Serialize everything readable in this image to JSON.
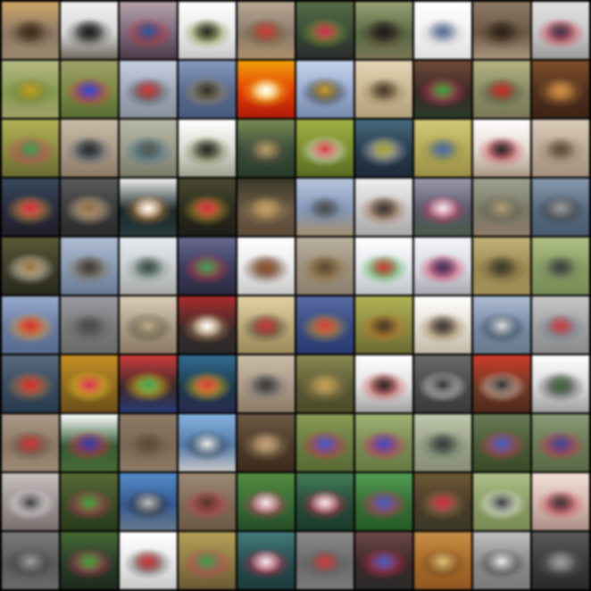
{
  "grid": {
    "rows": 10,
    "cols": 10,
    "border_color": "#000000",
    "tiles": [
      {
        "bg": "#8a7a6a",
        "top": "#c9a66e",
        "mid": "#5a4630",
        "bottom": "#9a8a72",
        "accent": "#3a2a1e"
      },
      {
        "bg": "#d8d8d8",
        "top": "#f0f0f0",
        "mid": "#3a3a34",
        "bottom": "#6e6a5e",
        "accent": "#1e1e1e"
      },
      {
        "bg": "#7a6a7a",
        "top": "#b4a4a8",
        "mid": "#b03030",
        "bottom": "#4a3a44",
        "accent": "#2a5a9a"
      },
      {
        "bg": "#e8e8e8",
        "top": "#ffffff",
        "mid": "#7a8a3a",
        "bottom": "#c8c8c8",
        "accent": "#2a2a2a"
      },
      {
        "bg": "#8a7a6e",
        "top": "#b8a898",
        "mid": "#6a5a3a",
        "bottom": "#a89070",
        "accent": "#c04040"
      },
      {
        "bg": "#3a4a3a",
        "top": "#5a6a4a",
        "mid": "#8aa040",
        "bottom": "#2a2a2a",
        "accent": "#c03050"
      },
      {
        "bg": "#5a6a4a",
        "top": "#9aa07a",
        "mid": "#3a2e22",
        "bottom": "#7a7458",
        "accent": "#1e1e1a"
      },
      {
        "bg": "#f2f2f2",
        "top": "#ffffff",
        "mid": "#b4b8c0",
        "bottom": "#e0e0e0",
        "accent": "#5a6a8a"
      },
      {
        "bg": "#6a5a4a",
        "top": "#8a7a6a",
        "mid": "#4a3a2a",
        "bottom": "#a89880",
        "accent": "#2a2018"
      },
      {
        "bg": "#c8c8c8",
        "top": "#e0e0e0",
        "mid": "#c03040",
        "bottom": "#9a9a9a",
        "accent": "#3a3a4a"
      },
      {
        "bg": "#8a9a5a",
        "top": "#b4b88a",
        "mid": "#6a7a3a",
        "bottom": "#a0a070",
        "accent": "#c0a030"
      },
      {
        "bg": "#7a8a4a",
        "top": "#a0a070",
        "mid": "#c03050",
        "bottom": "#5a6a3a",
        "accent": "#3050c0"
      },
      {
        "bg": "#a0a8b8",
        "top": "#c8d0e0",
        "mid": "#4a4a4a",
        "bottom": "#8a909a",
        "accent": "#c04040"
      },
      {
        "bg": "#5a6a8a",
        "top": "#8a9ab8",
        "mid": "#a08a5a",
        "bottom": "#4a5a7a",
        "accent": "#2a2a2a"
      },
      {
        "bg": "#d04010",
        "top": "#e8a020",
        "mid": "#f0d040",
        "bottom": "#a02010",
        "accent": "#ffffff"
      },
      {
        "bg": "#9aaac8",
        "top": "#c8d4e8",
        "mid": "#2a2a2a",
        "bottom": "#7a8aa8",
        "accent": "#c8a040"
      },
      {
        "bg": "#c8b898",
        "top": "#e0d4b8",
        "mid": "#8a7a5a",
        "bottom": "#b0a080",
        "accent": "#4a3a2a"
      },
      {
        "bg": "#3a2a2a",
        "top": "#6a4a3a",
        "mid": "#c04060",
        "bottom": "#2a3a2a",
        "accent": "#40a040"
      },
      {
        "bg": "#8a8a6a",
        "top": "#b4b48a",
        "mid": "#4a5a3a",
        "bottom": "#7a7a5a",
        "accent": "#c03030"
      },
      {
        "bg": "#4a3020",
        "top": "#7a5030",
        "mid": "#a07040",
        "bottom": "#3a2418",
        "accent": "#c89050"
      },
      {
        "bg": "#8a8a4a",
        "top": "#b0b060",
        "mid": "#c04060",
        "bottom": "#6a6a3a",
        "accent": "#40a050"
      },
      {
        "bg": "#a89a8a",
        "top": "#c8bca8",
        "mid": "#4a5a6a",
        "bottom": "#8a7a6a",
        "accent": "#2a2a2a"
      },
      {
        "bg": "#9a9a8a",
        "top": "#b8b8a8",
        "mid": "#3a6a8a",
        "bottom": "#7a7a6a",
        "accent": "#5a5a4a"
      },
      {
        "bg": "#d8d8d0",
        "top": "#ffffff",
        "mid": "#5a6a3a",
        "bottom": "#a0a090",
        "accent": "#2a2a2a"
      },
      {
        "bg": "#3a4a3a",
        "top": "#7a8a5a",
        "mid": "#6a5a4a",
        "bottom": "#2a3a2a",
        "accent": "#b0a070"
      },
      {
        "bg": "#7a8a3a",
        "top": "#a0b050",
        "mid": "#f0f0f0",
        "bottom": "#5a6a2a",
        "accent": "#c04040"
      },
      {
        "bg": "#2a3a4a",
        "top": "#4a6a7a",
        "mid": "#c0c0c0",
        "bottom": "#1e2a34",
        "accent": "#a0a040"
      },
      {
        "bg": "#b0a860",
        "top": "#d0c880",
        "mid": "#8a8a5a",
        "bottom": "#9a9050",
        "accent": "#4a6aa0"
      },
      {
        "bg": "#e0d8d0",
        "top": "#ffffff",
        "mid": "#c04050",
        "bottom": "#a89888",
        "accent": "#2a2a2a"
      },
      {
        "bg": "#b8a898",
        "top": "#d8ccbc",
        "mid": "#8a7a6a",
        "bottom": "#a09080",
        "accent": "#5a4a3a"
      },
      {
        "bg": "#2a2a3a",
        "top": "#3a4a5a",
        "mid": "#c8a050",
        "bottom": "#1e1e28",
        "accent": "#c03040"
      },
      {
        "bg": "#3a3a3a",
        "top": "#5a5a5a",
        "mid": "#d8c0a0",
        "bottom": "#2a2a2a",
        "accent": "#8a6a4a"
      },
      {
        "bg": "#1e2a2a",
        "top": "#f0f0f0",
        "mid": "#c08040",
        "bottom": "#2a3a3a",
        "accent": "#ffffff"
      },
      {
        "bg": "#2a2a1e",
        "top": "#4a4a34",
        "mid": "#c0a040",
        "bottom": "#1e1e18",
        "accent": "#c03040"
      },
      {
        "bg": "#6a5a4a",
        "top": "#3a3a2a",
        "mid": "#a08a5a",
        "bottom": "#5a4a3a",
        "accent": "#c0a070"
      },
      {
        "bg": "#8a9ab8",
        "top": "#b8c4d8",
        "mid": "#6a7a8a",
        "bottom": "#a09070",
        "accent": "#4a4a4a"
      },
      {
        "bg": "#c8c8c8",
        "top": "#f0f0f0",
        "mid": "#8a5a3a",
        "bottom": "#a8a8a8",
        "accent": "#3a3a3a"
      },
      {
        "bg": "#5a5a6a",
        "top": "#9a9aaa",
        "mid": "#c04060",
        "bottom": "#4a5a4a",
        "accent": "#f0f0f0"
      },
      {
        "bg": "#7a7a6a",
        "top": "#a0a090",
        "mid": "#5a5a4a",
        "bottom": "#8a7a6a",
        "accent": "#b0a080"
      },
      {
        "bg": "#5a6a7a",
        "top": "#8a9aaa",
        "mid": "#3a3a3a",
        "bottom": "#4a5a6a",
        "accent": "#a0a0a0"
      },
      {
        "bg": "#3a3a2a",
        "top": "#5a5a3a",
        "mid": "#f0e8d8",
        "bottom": "#2a2a1e",
        "accent": "#8a6a3a"
      },
      {
        "bg": "#8a9ab0",
        "top": "#b0bcd0",
        "mid": "#7a6a4a",
        "bottom": "#6a7a90",
        "accent": "#3a3a3a"
      },
      {
        "bg": "#c8ccd0",
        "top": "#e8ecf0",
        "mid": "#7a8a7a",
        "bottom": "#a8aaa8",
        "accent": "#3a4a4a"
      },
      {
        "bg": "#3a3a5a",
        "top": "#6a6a8a",
        "mid": "#c04040",
        "bottom": "#2a2a3a",
        "accent": "#40a060"
      },
      {
        "bg": "#e8e8e8",
        "top": "#ffffff",
        "mid": "#5a3a2a",
        "bottom": "#c8c8c8",
        "accent": "#8a5a3a"
      },
      {
        "bg": "#9a9080",
        "top": "#b8b0a0",
        "mid": "#8a6a3a",
        "bottom": "#8a8070",
        "accent": "#5a4a3a"
      },
      {
        "bg": "#e0e4e8",
        "top": "#ffffff",
        "mid": "#40a040",
        "bottom": "#c0c4c8",
        "accent": "#c04040"
      },
      {
        "bg": "#d8d8e0",
        "top": "#f4f4f8",
        "mid": "#c03050",
        "bottom": "#a8a8b0",
        "accent": "#3a3a5a"
      },
      {
        "bg": "#9a8a5a",
        "top": "#c0b080",
        "mid": "#6a5a3a",
        "bottom": "#a09060",
        "accent": "#3a3a2a"
      },
      {
        "bg": "#8a9a6a",
        "top": "#b0c08a",
        "mid": "#6a7a5a",
        "bottom": "#7a8a5a",
        "accent": "#3a3a3a"
      },
      {
        "bg": "#6a7a9a",
        "top": "#9aaac8",
        "mid": "#e0a040",
        "bottom": "#5a6a8a",
        "accent": "#c03030"
      },
      {
        "bg": "#7a7a7a",
        "top": "#9a9aa0",
        "mid": "#5a5a5a",
        "bottom": "#6a6a6a",
        "accent": "#4a4a4a"
      },
      {
        "bg": "#a89a88",
        "top": "#d8ccb8",
        "mid": "#4a4a3a",
        "bottom": "#8a7a6a",
        "accent": "#c0b090"
      },
      {
        "bg": "#3a2a2a",
        "top": "#a03030",
        "mid": "#c0a070",
        "bottom": "#2a2a2a",
        "accent": "#ffffff"
      },
      {
        "bg": "#b8a880",
        "top": "#e0d0a8",
        "mid": "#3a3a2a",
        "bottom": "#9a8a60",
        "accent": "#c04040"
      },
      {
        "bg": "#3a4a7a",
        "top": "#5a6a9a",
        "mid": "#c0a040",
        "bottom": "#2a3a6a",
        "accent": "#c04040"
      },
      {
        "bg": "#8a8a4a",
        "top": "#b0b060",
        "mid": "#c07030",
        "bottom": "#6a6a3a",
        "accent": "#3a3a2a"
      },
      {
        "bg": "#e0dcd0",
        "top": "#ffffff",
        "mid": "#8a6a4a",
        "bottom": "#c0b8a8",
        "accent": "#3a3a3a"
      },
      {
        "bg": "#7a8aa0",
        "top": "#b0bcd0",
        "mid": "#2a3a4a",
        "bottom": "#6a7a8a",
        "accent": "#e0e0e0"
      },
      {
        "bg": "#a0a0a0",
        "top": "#c8c8c8",
        "mid": "#6a7a8a",
        "bottom": "#8a8a8a",
        "accent": "#c04040"
      },
      {
        "bg": "#3a4a5a",
        "top": "#5a6a7a",
        "mid": "#b08050",
        "bottom": "#2a3a4a",
        "accent": "#c03030"
      },
      {
        "bg": "#8a6a2a",
        "top": "#c09030",
        "mid": "#f0d040",
        "bottom": "#6a5020",
        "accent": "#c03050"
      },
      {
        "bg": "#3a2a2a",
        "top": "#c04040",
        "mid": "#f0c030",
        "bottom": "#2a3a6a",
        "accent": "#40a060"
      },
      {
        "bg": "#1e3a4a",
        "top": "#3a6a8a",
        "mid": "#f0c030",
        "bottom": "#2a2a4a",
        "accent": "#c04040"
      },
      {
        "bg": "#a89a8a",
        "top": "#c8bcaa",
        "mid": "#6a6a6a",
        "bottom": "#8a7a6a",
        "accent": "#3a3a3a"
      },
      {
        "bg": "#5a5a3a",
        "top": "#8a8a5a",
        "mid": "#a08a5a",
        "bottom": "#4a4a2a",
        "accent": "#c0a060"
      },
      {
        "bg": "#e0e0e0",
        "top": "#ffffff",
        "mid": "#c04040",
        "bottom": "#a0a0a0",
        "accent": "#2a2a2a"
      },
      {
        "bg": "#4a4a4a",
        "top": "#6a6a6a",
        "mid": "#f0f0f0",
        "bottom": "#3a3a3a",
        "accent": "#2a2a2a"
      },
      {
        "bg": "#6a3a2a",
        "top": "#c04030",
        "mid": "#f0e0d0",
        "bottom": "#4a2a1e",
        "accent": "#2a2a2a"
      },
      {
        "bg": "#d8d8d8",
        "top": "#ffffff",
        "mid": "#3a3a3a",
        "bottom": "#a0a0a0",
        "accent": "#4a6a4a"
      },
      {
        "bg": "#8a7a6a",
        "top": "#a8988a",
        "mid": "#5a4a3a",
        "bottom": "#9a8a7a",
        "accent": "#c04040"
      },
      {
        "bg": "#3a5a3a",
        "top": "#ffffff",
        "mid": "#c03040",
        "bottom": "#4a6a3a",
        "accent": "#3040a0"
      },
      {
        "bg": "#7a6a5a",
        "top": "#8a7a6a",
        "mid": "#6a5a4a",
        "bottom": "#8a7a6a",
        "accent": "#5a4a3a"
      },
      {
        "bg": "#5a7aa0",
        "top": "#8ab0d8",
        "mid": "#2a3a4a",
        "bottom": "#c8c8c8",
        "accent": "#f0f0f0"
      },
      {
        "bg": "#4a3a2a",
        "top": "#6a5a4a",
        "mid": "#a08a6a",
        "bottom": "#3a2a1e",
        "accent": "#c0a080"
      },
      {
        "bg": "#6a7a4a",
        "top": "#8a9a5a",
        "mid": "#c03050",
        "bottom": "#5a6a3a",
        "accent": "#4060c0"
      },
      {
        "bg": "#7a8a5a",
        "top": "#a0b07a",
        "mid": "#c03060",
        "bottom": "#6a7a4a",
        "accent": "#4050b0"
      },
      {
        "bg": "#9aa08a",
        "top": "#c0c8b0",
        "mid": "#5a6a5a",
        "bottom": "#8a907a",
        "accent": "#3a3a3a"
      },
      {
        "bg": "#4a5a3a",
        "top": "#6a7a5a",
        "mid": "#c04060",
        "bottom": "#3a4a2a",
        "accent": "#4060b0"
      },
      {
        "bg": "#6a7a5a",
        "top": "#8a9a7a",
        "mid": "#c03050",
        "bottom": "#5a6a4a",
        "accent": "#3a4a8a"
      },
      {
        "bg": "#9a9090",
        "top": "#c8c0c0",
        "mid": "#f0f0f0",
        "bottom": "#7a7070",
        "accent": "#3a3a3a"
      },
      {
        "bg": "#3a4a2a",
        "top": "#5a6a3a",
        "mid": "#c04060",
        "bottom": "#2a3a1e",
        "accent": "#40a040"
      },
      {
        "bg": "#3a5a8a",
        "top": "#5a8ac0",
        "mid": "#2a2a2a",
        "bottom": "#6a7a8a",
        "accent": "#c0c0c0"
      },
      {
        "bg": "#7a6a5a",
        "top": "#9a8a7a",
        "mid": "#c04050",
        "bottom": "#6a5a4a",
        "accent": "#4a3a2a"
      },
      {
        "bg": "#3a6a3a",
        "top": "#5a8a4a",
        "mid": "#c04060",
        "bottom": "#2a4a2a",
        "accent": "#f0f0f0"
      },
      {
        "bg": "#2a4a3a",
        "top": "#4a7a5a",
        "mid": "#c03050",
        "bottom": "#1e3a2a",
        "accent": "#f0f0f0"
      },
      {
        "bg": "#3a6a3a",
        "top": "#5a9a5a",
        "mid": "#c04060",
        "bottom": "#2a5a2a",
        "accent": "#4060b0"
      },
      {
        "bg": "#4a3a2a",
        "top": "#6a5a3a",
        "mid": "#8a7a5a",
        "bottom": "#3a3a2a",
        "accent": "#c03040"
      },
      {
        "bg": "#8a9a6a",
        "top": "#b0c090",
        "mid": "#ffffff",
        "bottom": "#7a8a5a",
        "accent": "#3a3a3a"
      },
      {
        "bg": "#d0b8b0",
        "top": "#f0e0d8",
        "mid": "#c04050",
        "bottom": "#a89088",
        "accent": "#3a3a3a"
      },
      {
        "bg": "#5a5a5a",
        "top": "#7a7a7a",
        "mid": "#3a3a3a",
        "bottom": "#6a6a6a",
        "accent": "#a0a0a0"
      },
      {
        "bg": "#2a3a2a",
        "top": "#4a6a3a",
        "mid": "#c04060",
        "bottom": "#1e2a1e",
        "accent": "#40a040"
      },
      {
        "bg": "#e8e8e8",
        "top": "#ffffff",
        "mid": "#4a4a4a",
        "bottom": "#c8c8c8",
        "accent": "#c04040"
      },
      {
        "bg": "#8a7a4a",
        "top": "#b0a060",
        "mid": "#c04060",
        "bottom": "#6a5a3a",
        "accent": "#40a050"
      },
      {
        "bg": "#2a4a4a",
        "top": "#4a7a7a",
        "mid": "#c03050",
        "bottom": "#1e3a3a",
        "accent": "#f0f0f0"
      },
      {
        "bg": "#6a6a6a",
        "top": "#8a8a8a",
        "mid": "#5a5a5a",
        "bottom": "#7a7a7a",
        "accent": "#c04040"
      },
      {
        "bg": "#3a2a2a",
        "top": "#6a4a4a",
        "mid": "#c03050",
        "bottom": "#2a2a2a",
        "accent": "#4060b0"
      },
      {
        "bg": "#a06a30",
        "top": "#c09050",
        "mid": "#6a4a2a",
        "bottom": "#8a5a2a",
        "accent": "#e0c080"
      },
      {
        "bg": "#8a8a8a",
        "top": "#c0c0c0",
        "mid": "#3a3a3a",
        "bottom": "#7a7a7a",
        "accent": "#f0f0f0"
      },
      {
        "bg": "#3a3a3a",
        "top": "#5a5a5a",
        "mid": "#6a6a6a",
        "bottom": "#2a2a2a",
        "accent": "#a0a0a0"
      }
    ]
  }
}
